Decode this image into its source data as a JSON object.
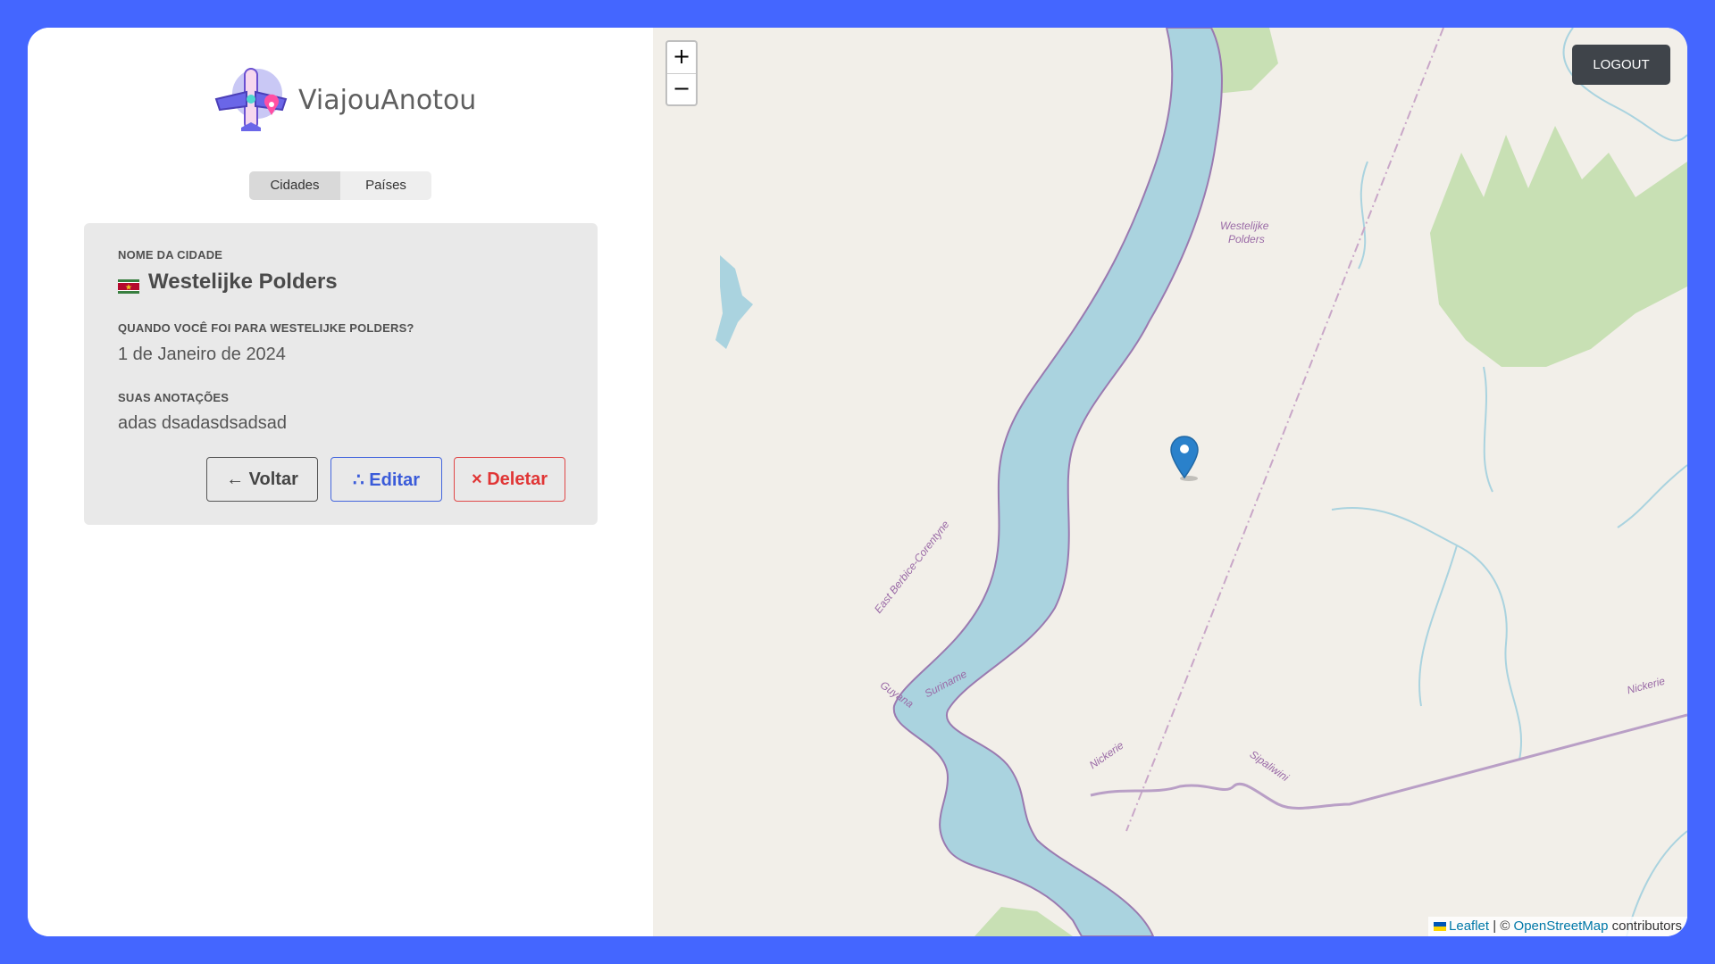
{
  "brand": {
    "name": "ViajouAnotou"
  },
  "tabs": [
    {
      "label": "Cidades",
      "active": true
    },
    {
      "label": "Países",
      "active": false
    }
  ],
  "city_card": {
    "name_label": "NOME DA CIDADE",
    "flag_icon": "suriname-flag",
    "city_name": "Westelijke Polders",
    "date_label": "QUANDO VOCÊ FOI PARA WESTELIJKE POLDERS?",
    "date_value": "1 de Janeiro de 2024",
    "notes_label": "SUAS ANOTAÇÕES",
    "notes_value": "adas dsadasdsadsad",
    "back_label": "← Voltar",
    "edit_label": "∴ Editar",
    "delete_label": "× Deletar"
  },
  "map": {
    "zoom_in": "+",
    "zoom_out": "−",
    "logout_label": "LOGOUT",
    "labels": {
      "polders_line1": "Westelijke",
      "polders_line2": "Polders",
      "corentyne": "East Berbice-Corentyne",
      "suriname": "Suriname",
      "guyana": "Guyana",
      "nickerie_left": "Nickerie",
      "sipaliwini": "Sipaliwini",
      "nickerie_right": "Nickerie"
    },
    "attribution": {
      "leaflet": "Leaflet",
      "separator": "| ©",
      "osm": "OpenStreetMap",
      "contributors": "contributors"
    }
  },
  "colors": {
    "background": "#4466ff",
    "water": "#aad3df",
    "forest": "#c8e0b4",
    "land": "#f2efe9",
    "marker": "#2a81cb"
  }
}
